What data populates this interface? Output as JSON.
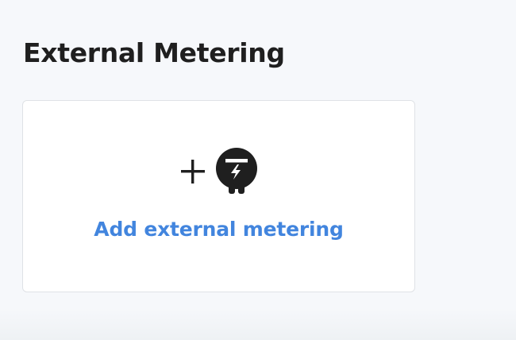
{
  "section": {
    "title": "External Metering"
  },
  "add_card": {
    "plus_icon": "plus-icon",
    "meter_icon": "external-meter-icon",
    "label": "Add external metering",
    "label_color": "#4285de",
    "icon_color": "#1f1f1f"
  }
}
